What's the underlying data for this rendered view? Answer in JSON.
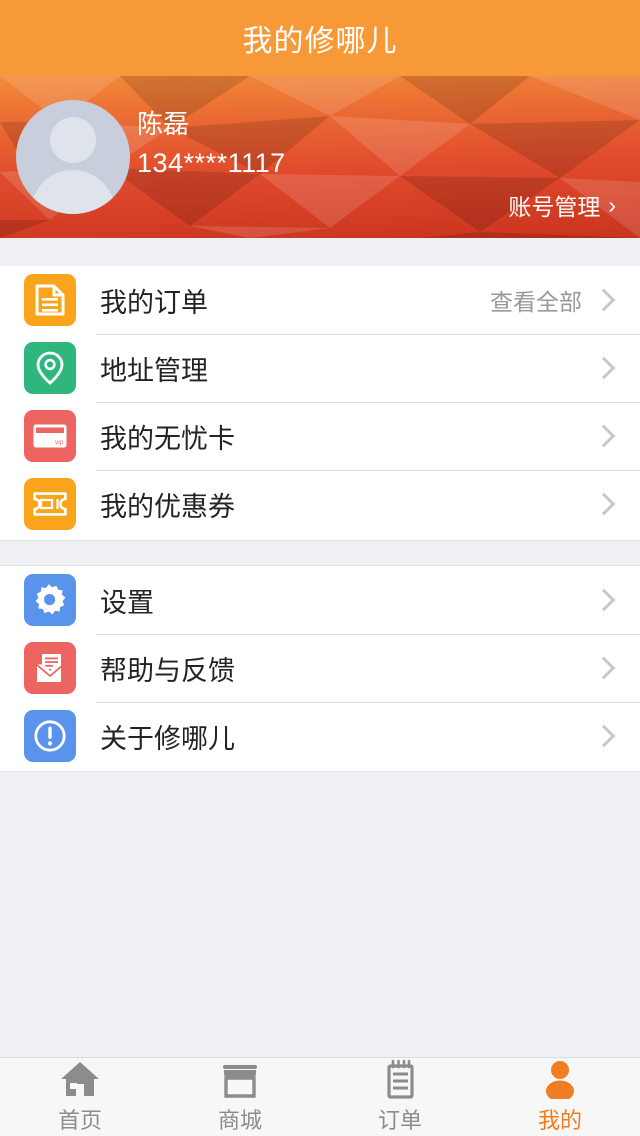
{
  "titlebar": {
    "title": "我的修哪儿",
    "bg": "#F89938"
  },
  "profile": {
    "name": "陈磊",
    "phone": "134****1117",
    "account_link": "账号管理",
    "account_arrow": "›",
    "avatar_icon": "default-user-avatar",
    "gradient_top": "#F28B38",
    "gradient_bottom": "#C9341F"
  },
  "groups": [
    {
      "items": [
        {
          "icon": "document-icon",
          "label": "我的订单",
          "aside": "查看全部",
          "tile_color": "#F9A41B"
        },
        {
          "icon": "location-pin-icon",
          "label": "地址管理",
          "aside": "",
          "tile_color": "#2EB67D"
        },
        {
          "icon": "vip-card-icon",
          "label": "我的无忧卡",
          "aside": "",
          "tile_color": "#EC6560"
        },
        {
          "icon": "coupon-ticket-icon",
          "label": "我的优惠券",
          "aside": "",
          "tile_color": "#F9A41B"
        }
      ]
    },
    {
      "items": [
        {
          "icon": "gear-icon",
          "label": "设置",
          "aside": "",
          "tile_color": "#5A93EB"
        },
        {
          "icon": "envelope-icon",
          "label": "帮助与反馈",
          "aside": "",
          "tile_color": "#EC6560"
        },
        {
          "icon": "info-exclamation-icon",
          "label": "关于修哪儿",
          "aside": "",
          "tile_color": "#5A93EB"
        }
      ]
    }
  ],
  "tabbar": {
    "active_color": "#F07D22",
    "inactive_color": "#8C8C8C",
    "tabs": [
      {
        "icon": "home-icon",
        "label": "首页",
        "active": false
      },
      {
        "icon": "store-icon",
        "label": "商城",
        "active": false
      },
      {
        "icon": "order-list-icon",
        "label": "订单",
        "active": false
      },
      {
        "icon": "person-icon",
        "label": "我的",
        "active": true
      }
    ]
  }
}
